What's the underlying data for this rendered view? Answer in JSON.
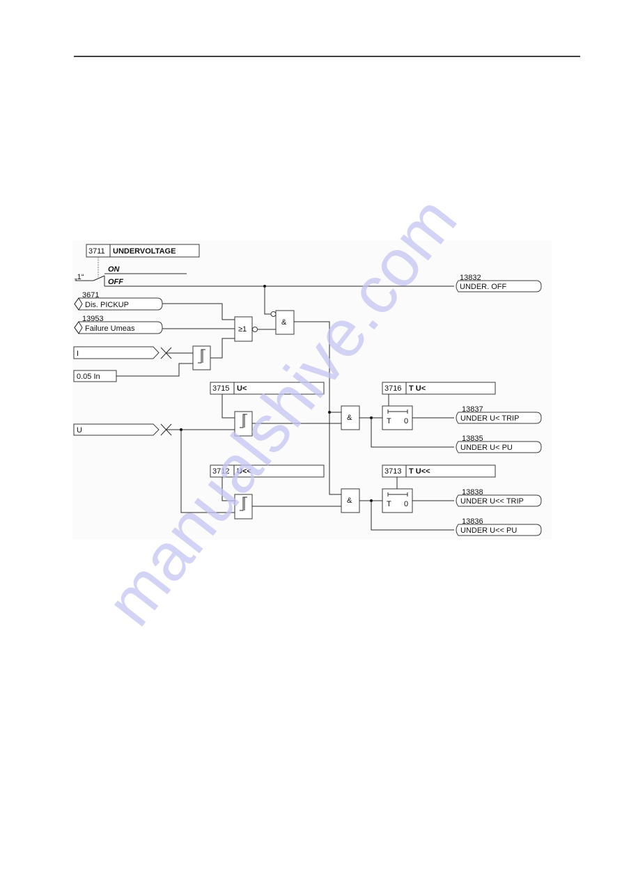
{
  "page": {
    "header_rule": true,
    "watermark": "manualshive.com"
  },
  "diagram": {
    "setting_main": {
      "address": "3711",
      "name": "UNDERVOLTAGE"
    },
    "switch": {
      "const_label": "„1“",
      "on_label": "ON",
      "off_label": "OFF"
    },
    "inputs": {
      "dis_pickup": {
        "number": "3671",
        "label": "Dis. PICKUP"
      },
      "failure_umeas": {
        "number": "13953",
        "label": "Failure Umeas"
      },
      "current": {
        "label": "I"
      },
      "current_threshold": {
        "label": "0.05 In"
      },
      "voltage": {
        "label": "U"
      }
    },
    "gates": {
      "or_gate": "≥1",
      "and_gate": "&"
    },
    "settings": {
      "u_less": {
        "address": "3715",
        "name": "U<"
      },
      "t_u_less": {
        "address": "3716",
        "name": "T U<"
      },
      "u_less_less": {
        "address": "3712",
        "name": "U<<"
      },
      "t_u_less_less": {
        "address": "3713",
        "name": "T U<<"
      }
    },
    "timer": {
      "t_label": "T",
      "zero_label": "0"
    },
    "outputs": {
      "under_off": {
        "number": "13832",
        "label": "UNDER. OFF"
      },
      "u_less_trip": {
        "number": "13837",
        "label": "UNDER U< TRIP"
      },
      "u_less_pu": {
        "number": "13835",
        "label": "UNDER U< PU"
      },
      "u_less_less_trip": {
        "number": "13838",
        "label": "UNDER U<< TRIP"
      },
      "u_less_less_pu": {
        "number": "13836",
        "label": "UNDER U<< PU"
      }
    },
    "colors": {
      "line": "#2a2a2a",
      "watermark": "#c5c5f2",
      "diagram_bg": "#fbfbfb"
    }
  }
}
